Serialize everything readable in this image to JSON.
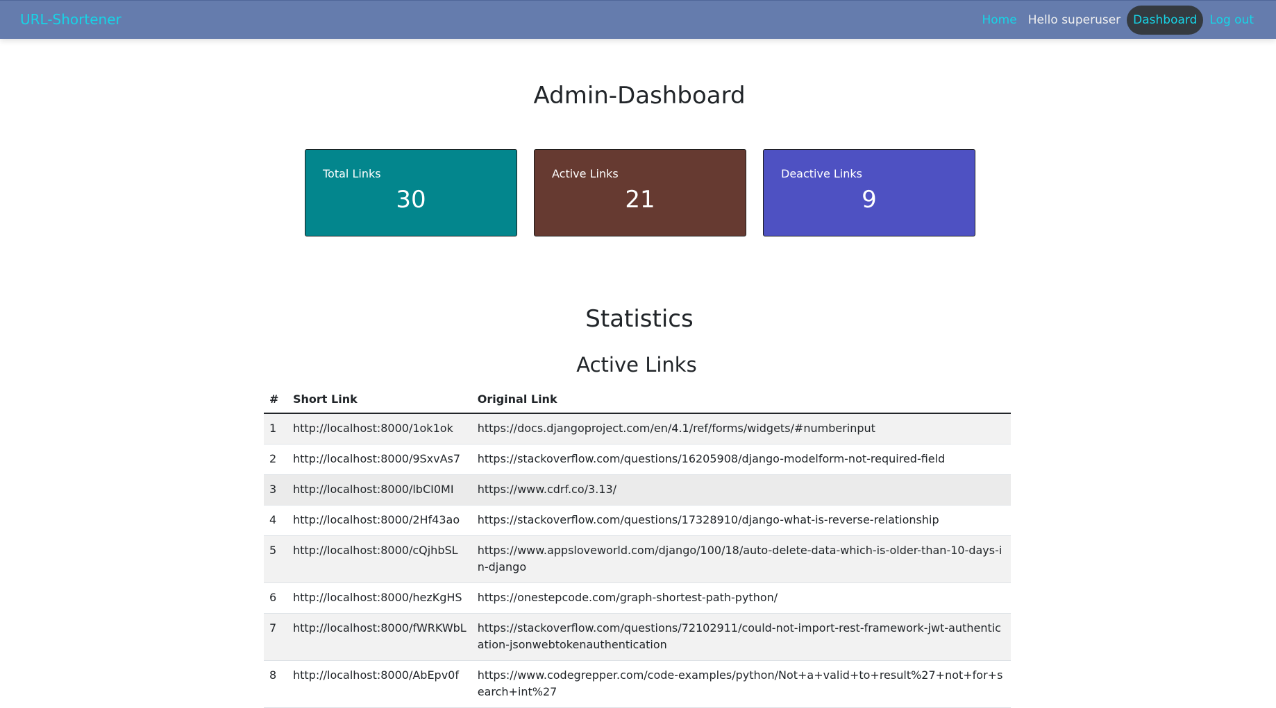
{
  "navbar": {
    "brand": "URL-Shortener",
    "home": "Home",
    "greeting": "Hello superuser",
    "dashboard": "Dashboard",
    "logout": "Log out"
  },
  "page_title": "Admin-Dashboard",
  "cards": {
    "total": {
      "label": "Total Links",
      "value": "30",
      "color": "#03868d"
    },
    "active": {
      "label": "Active Links",
      "value": "21",
      "color": "#663a31"
    },
    "deactive": {
      "label": "Deactive Links",
      "value": "9",
      "color": "#4e51c2"
    }
  },
  "statistics_title": "Statistics",
  "active_links": {
    "title": "Active Links",
    "headers": [
      "#",
      "Short Link",
      "Original Link"
    ],
    "rows": [
      [
        "1",
        "http://localhost:8000/1ok1ok",
        "https://docs.djangoproject.com/en/4.1/ref/forms/widgets/#numberinput"
      ],
      [
        "2",
        "http://localhost:8000/9SxvAs7",
        "https://stackoverflow.com/questions/16205908/django-modelform-not-required-field"
      ],
      [
        "3",
        "http://localhost:8000/lbCI0MI",
        "https://www.cdrf.co/3.13/"
      ],
      [
        "4",
        "http://localhost:8000/2Hf43ao",
        "https://stackoverflow.com/questions/17328910/django-what-is-reverse-relationship"
      ],
      [
        "5",
        "http://localhost:8000/cQjhbSL",
        "https://www.appsloveworld.com/django/100/18/auto-delete-data-which-is-older-than-10-days-in-django"
      ],
      [
        "6",
        "http://localhost:8000/hezKgHS",
        "https://onestepcode.com/graph-shortest-path-python/"
      ],
      [
        "7",
        "http://localhost:8000/fWRKWbL",
        "https://stackoverflow.com/questions/72102911/could-not-import-rest-framework-jwt-authentication-jsonwebtokenauthentication"
      ],
      [
        "8",
        "http://localhost:8000/AbEpv0f",
        "https://www.codegrepper.com/code-examples/python/Not+a+valid+to+result%27+not+for+search+int%27"
      ]
    ]
  }
}
